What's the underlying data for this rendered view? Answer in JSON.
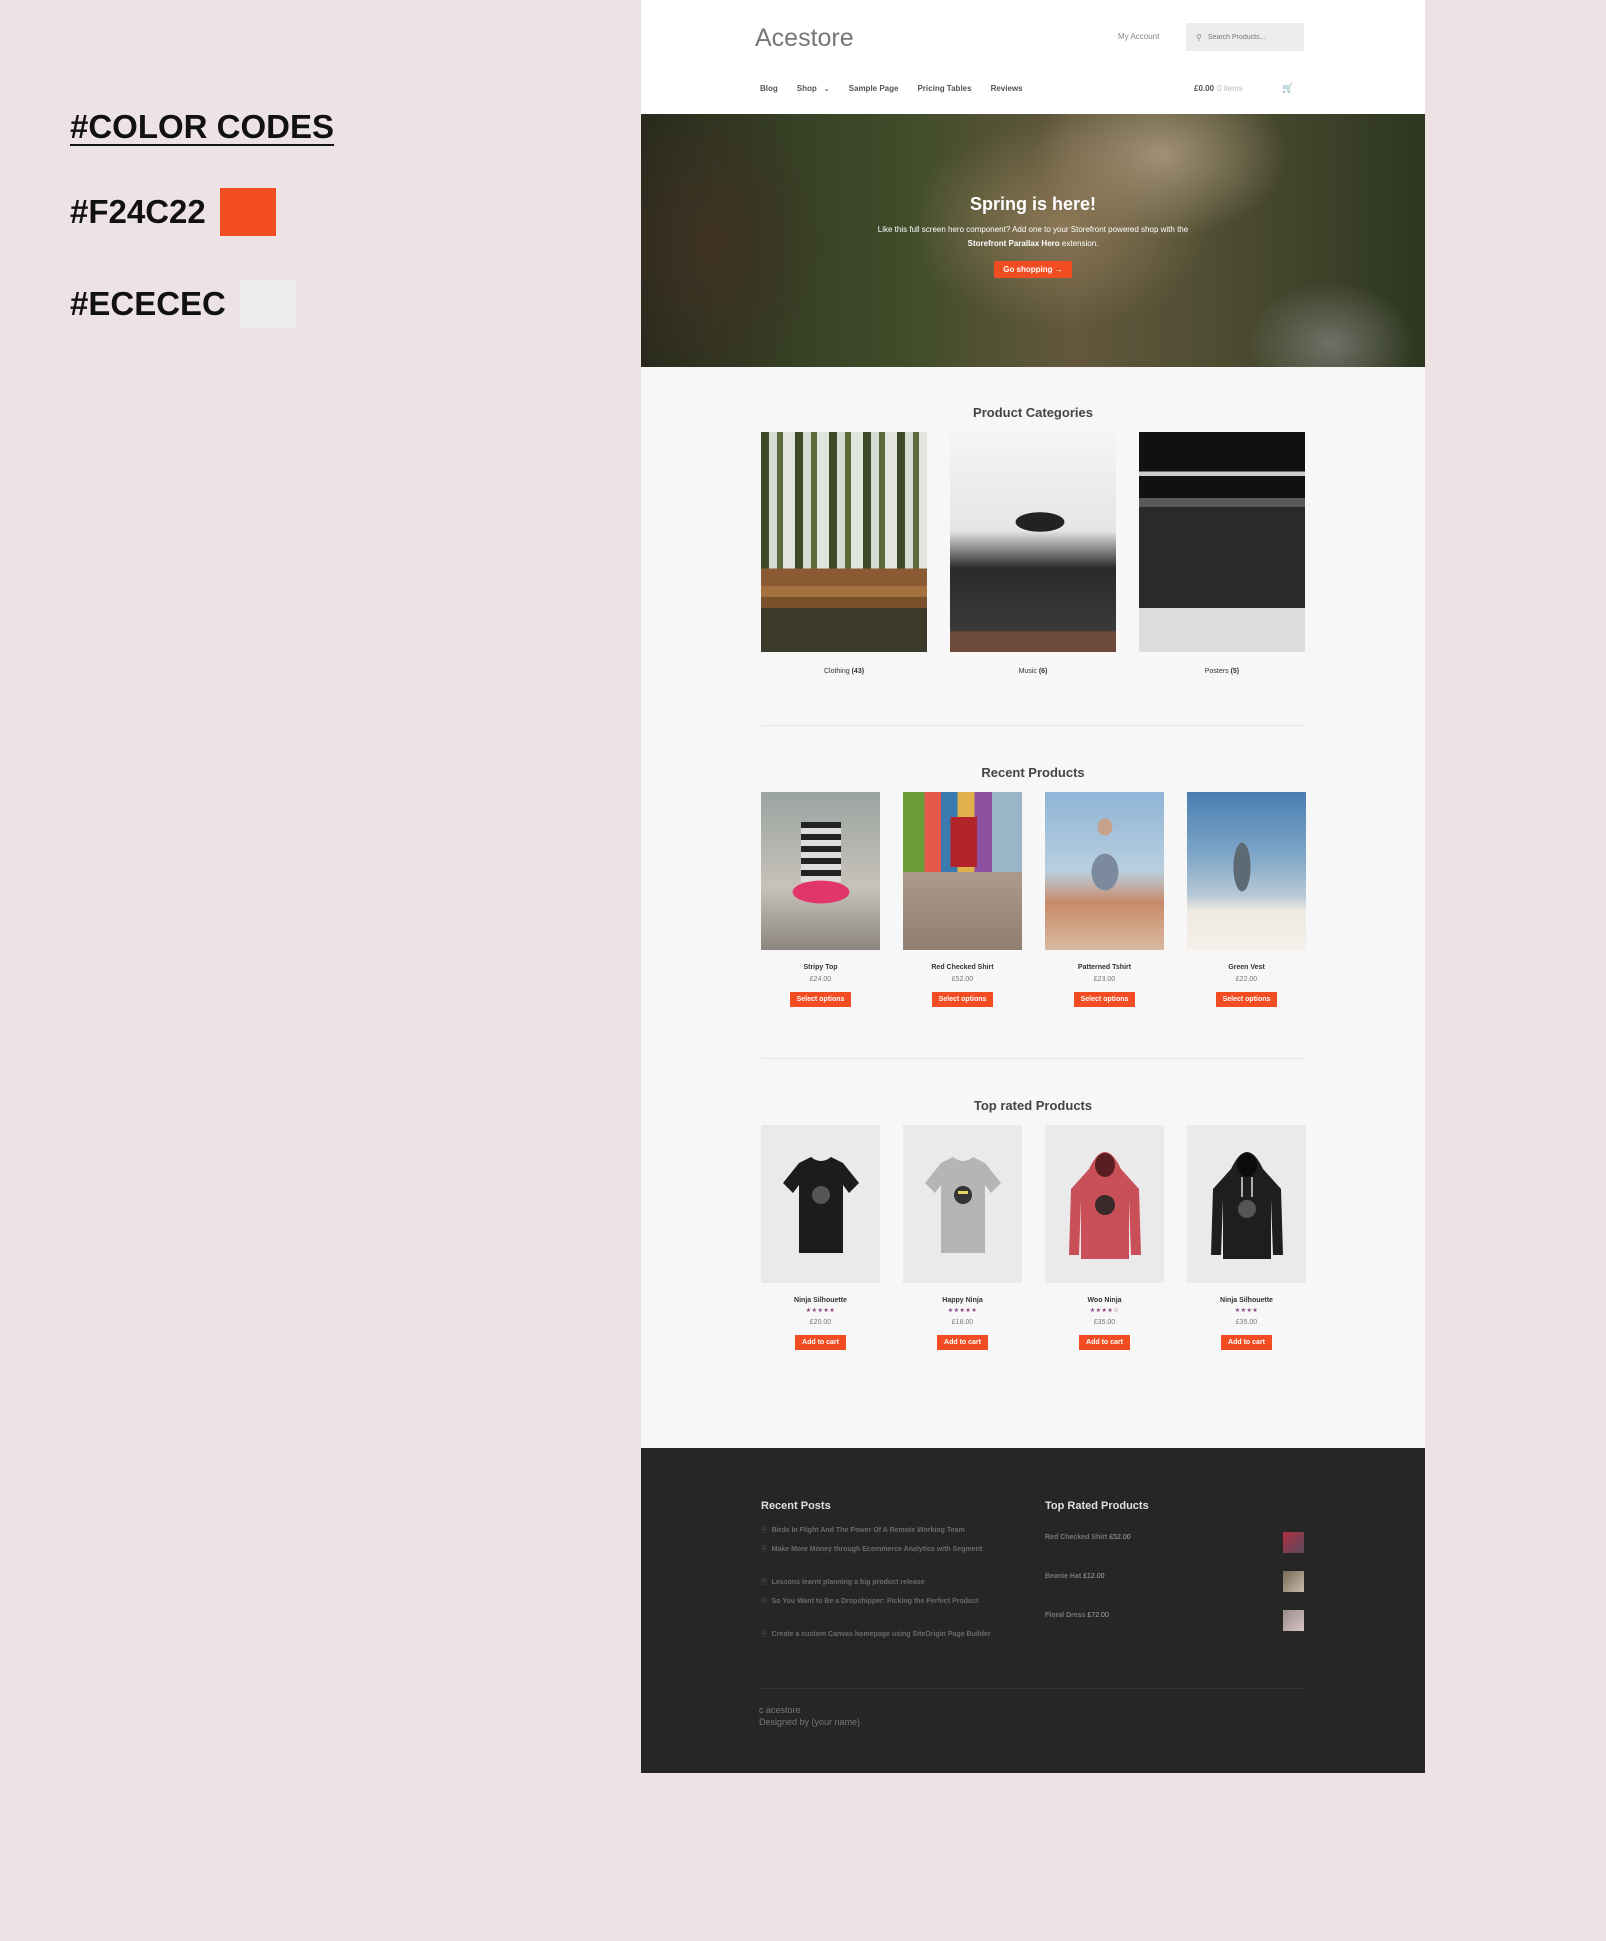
{
  "palette": {
    "title": "#COLOR CODES",
    "colors": [
      {
        "code": "#F24C22",
        "hex": "#F24C22"
      },
      {
        "code": "#ECECEC",
        "hex": "#ECECEC"
      }
    ]
  },
  "header": {
    "logo": "Acestore",
    "my_account": "My Account",
    "search_placeholder": "Search Products...",
    "nav": [
      "Blog",
      "Shop",
      "Sample Page",
      "Pricing Tables",
      "Reviews"
    ],
    "cart_total": "£0.00",
    "cart_items": "0 items"
  },
  "hero": {
    "title": "Spring is here!",
    "text_1": "Like this full screen hero component? Add one to your Storefront powered shop with the",
    "text_bold": "Storefront Parallax Hero",
    "text_2": "extension.",
    "button": "Go shopping →"
  },
  "categories": {
    "title": "Product Categories",
    "items": [
      {
        "name": "Clothing",
        "count": "(43)"
      },
      {
        "name": "Music",
        "count": "(6)"
      },
      {
        "name": "Posters",
        "count": "(5)"
      }
    ]
  },
  "recent": {
    "title": "Recent Products",
    "items": [
      {
        "name": "Stripy Top",
        "price": "£24.00",
        "button": "Select options"
      },
      {
        "name": "Red Checked Shirt",
        "price": "£52.00",
        "button": "Select options"
      },
      {
        "name": "Patterned Tshirt",
        "price": "£23.00",
        "button": "Select options"
      },
      {
        "name": "Green Vest",
        "price": "£22.00",
        "button": "Select options"
      }
    ]
  },
  "top_rated": {
    "title": "Top rated Products",
    "items": [
      {
        "name": "Ninja Silhouette",
        "stars": "★★★★★",
        "rating": 5,
        "price": "£20.00",
        "button": "Add to cart"
      },
      {
        "name": "Happy Ninja",
        "stars": "★★★★★",
        "rating": 5,
        "price": "£18.00",
        "button": "Add to cart"
      },
      {
        "name": "Woo Ninja",
        "stars": "★★★★☆",
        "rating": 4.5,
        "price": "£35.00",
        "button": "Add to cart"
      },
      {
        "name": "Ninja Silhouette",
        "stars": "★★★★",
        "rating": 4,
        "price": "£35.00",
        "button": "Add to cart"
      }
    ]
  },
  "footer": {
    "recent_posts_title": "Recent Posts",
    "posts": [
      "Birds In Flight And The Power Of A Remote Working Team",
      "Make More Money through Ecommerce Analytics with Segment",
      "Lessons learnt planning a big product release",
      "So You Want to Be a Dropshipper: Picking the Perfect Product",
      "Create a custom Canvas homepage using SiteOrigin Page Builder"
    ],
    "top_rated_title": "Top Rated Products",
    "top_rated": [
      {
        "name": "Red Checked Shirt",
        "price": "£52.00"
      },
      {
        "name": "Beanie Hat",
        "price": "£12.00"
      },
      {
        "name": "Floral Dress",
        "price": "£72.00"
      }
    ],
    "credit_1": "c acestore",
    "credit_2": "Designed by (your name)"
  }
}
